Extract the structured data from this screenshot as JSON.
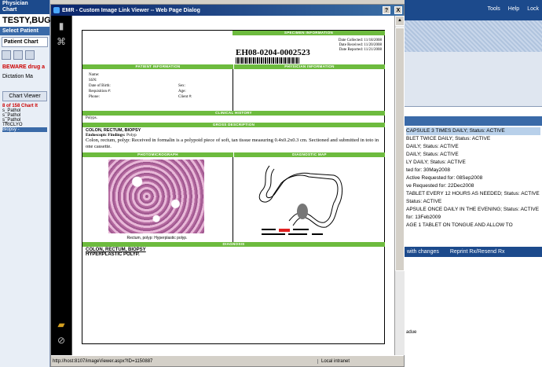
{
  "background": {
    "left": {
      "role": "Physician",
      "menu": "Chart",
      "patient_name": "TESTY,BUG:",
      "select_patient": "Select Patient",
      "tab_patient_chart": "Patient Chart",
      "warning": "BEWARE drug a",
      "dictation": "Dictation",
      "dictation_value": "Ma",
      "chart_viewer": "Chart Viewer",
      "tree_header": "8 of 158 Chart It",
      "tree_items": [
        "s_Pathol",
        "s_Pathol",
        "s_Pathol",
        "TRICLYO",
        "Biopsy -"
      ]
    },
    "right": {
      "tools": "Tools",
      "help": "Help",
      "lock": "Lock",
      "meds": [
        "CAPSULE 3 TIMES DAILY; Status: ACTIVE",
        "BLET TWICE DAILY; Status: ACTIVE",
        "DAILY; Status: ACTIVE",
        "DAILY; Status: ACTIVE",
        "LY DAILY; Status: ACTIVE",
        "ted for: 30May2008",
        "Active  Requested for: 08Sep2008",
        "ve  Requested for: 22Dec2008",
        "TABLET EVERY 12 HOURS AS NEEDED; Status: ACTIVE",
        "Status: ACTIVE",
        "APSULE ONCE DAILY IN THE EVENING; Status: ACTIVE",
        "for: 13Feb2009",
        "AGE 1 TABLET ON TONGUE AND ALLOW TO"
      ],
      "btn_changes": "with changes",
      "btn_reprint": "Reprint Rx/Resend Rx",
      "bottom_text": "adue"
    }
  },
  "dialog": {
    "title": "EMR - Custom Image Link Viewer -- Web Page Dialog",
    "help_btn": "?",
    "close_btn": "X",
    "status_url": "http://host:8107/imageViewer.aspx?ID=1150887",
    "status_zone": "Local intranet"
  },
  "report": {
    "specimen_header": "SPECIMEN INFORMATION",
    "accession": "EH08-0204-0002523",
    "date_labels": [
      "Date Collected:",
      "Date Received:",
      "Date Reported:"
    ],
    "date_values": [
      "11/18/2008",
      "11/20/2008",
      "11/21/2008"
    ],
    "patient_header": "PATIENT INFORMATION",
    "physician_header": "PHYSICIAN INFORMATION",
    "fields_left": [
      "Name:",
      "SSN:",
      "Date of Birth:",
      "Requisition #:",
      "Phone:"
    ],
    "fields_right": [
      "Sex:",
      "Age:",
      "Client #:"
    ],
    "clinical_header": "CLINICAL HISTORY",
    "clinical_text": "Polyps.",
    "gross_header": "GROSS DESCRIPTION",
    "gross_title": "COLON, RECTUM, BIOPSY",
    "gross_endo_label": "Endoscopic Findings:",
    "gross_endo_value": "Polyp",
    "gross_text": "Colon, rectum, polyp:  Received in formalin is a polypoid piece of soft, tan tissue measuring 0.4x0.2x0.3 cm.  Sectioned and submitted in toto in one cassette.",
    "photo_header": "PHOTOMICROGRAPH",
    "map_header": "DIAGNOSTIC MAP",
    "photo_caption": "Rectum, polyp: Hyperplastic polyp.",
    "dx_header": "DIAGNOSIS",
    "dx_title": "COLON, RECTUM, BIOPSY",
    "dx_text": "HYPERPLASTIC POLYP."
  },
  "colors": {
    "green": "#6dbb3e",
    "titlebar": "#0a246a",
    "highlight": "#e02020"
  }
}
